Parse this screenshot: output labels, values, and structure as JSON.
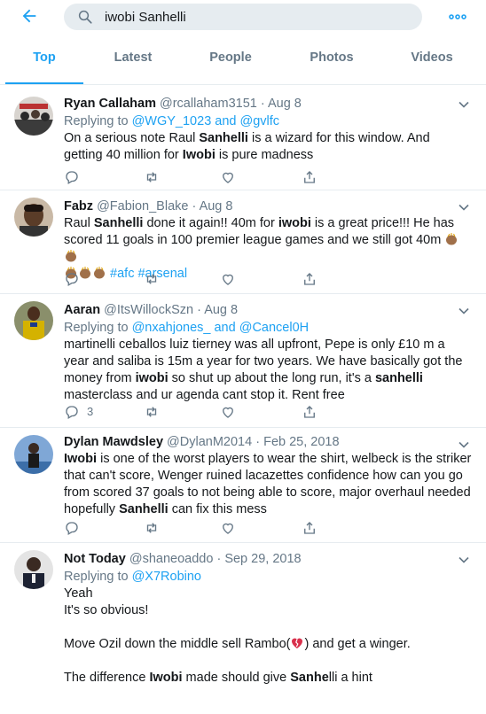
{
  "search": {
    "query": "iwobi Sanhelli"
  },
  "tabs": [
    {
      "label": "Top"
    },
    {
      "label": "Latest"
    },
    {
      "label": "People"
    },
    {
      "label": "Photos"
    },
    {
      "label": "Videos"
    }
  ],
  "tweets": [
    {
      "name": "Ryan Callaham",
      "handle": "@rcallaham3151",
      "sep": "·",
      "date": "Aug 8",
      "replying_prefix": "Replying to",
      "replying_to": "@WGY_1023 and @gvlfc",
      "text_parts": [
        "On a serious note Raul ",
        "Sanhelli",
        " is a wizard for this window. And getting 40 million for ",
        "Iwobi",
        " is pure madness"
      ],
      "reply_count": ""
    },
    {
      "name": "Fabz",
      "handle": "@Fabion_Blake",
      "sep": "·",
      "date": "Aug 8",
      "text_parts": [
        "Raul ",
        "Sanhelli",
        " done it again!! 40m for ",
        "iwobi",
        " is a great price!!! He has scored 11 goals in 100 premier league games and we still got 40m "
      ],
      "hashtags": "#afc #arsenal",
      "reply_count": ""
    },
    {
      "name": "Aaran",
      "handle": "@ItsWillockSzn",
      "sep": "·",
      "date": "Aug 8",
      "replying_prefix": "Replying to",
      "replying_to": "@nxahjones_ and @Cancel0H",
      "text_parts": [
        "martinelli ceballos luiz tierney was all upfront, Pepe is only £10 m a year and saliba is 15m a year for two years. We have basically got the money from ",
        "iwobi",
        " so shut up about the long run, it's a ",
        "sanhelli",
        " masterclass and ur agenda cant stop it. Rent free"
      ],
      "reply_count": "3"
    },
    {
      "name": "Dylan Mawdsley",
      "handle": "@DylanM2014",
      "sep": "·",
      "date": "Feb 25, 2018",
      "text_parts": [
        "Iwobi",
        " is one of the worst players to wear the shirt, welbeck is the striker that can't score, Wenger ruined lacazettes confidence how can you go from scored 37 goals to not being able to score, major overhaul needed hopefully ",
        "Sanhelli",
        " can fix this mess"
      ],
      "reply_count": ""
    },
    {
      "name": "Not Today",
      "handle": "@shaneoaddo",
      "sep": "·",
      "date": "Sep 29, 2018",
      "replying_prefix": "Replying to",
      "replying_to": "@X7Robino",
      "lines": [
        "Yeah",
        "It's so obvious!",
        "",
        "Move Ozil down the middle sell Rambo(",
        ") and get a winger.",
        "",
        "The difference ",
        "Iwobi",
        " made should give ",
        "Sanhe",
        "lli a hint"
      ],
      "reply_count": ""
    }
  ],
  "icons": {
    "back": "back-arrow-icon",
    "search": "search-icon",
    "more": "more-dots-icon",
    "reply": "reply-icon",
    "retweet": "retweet-icon",
    "like": "heart-icon",
    "share": "share-icon",
    "chevron": "chevron-down-icon",
    "clap": "clapping-hands-emoji",
    "broken_heart": "broken-heart-emoji"
  },
  "colors": {
    "accent": "#1da1f2",
    "text": "#14171a",
    "secondary": "#657786",
    "divider": "#e6ecf0"
  }
}
